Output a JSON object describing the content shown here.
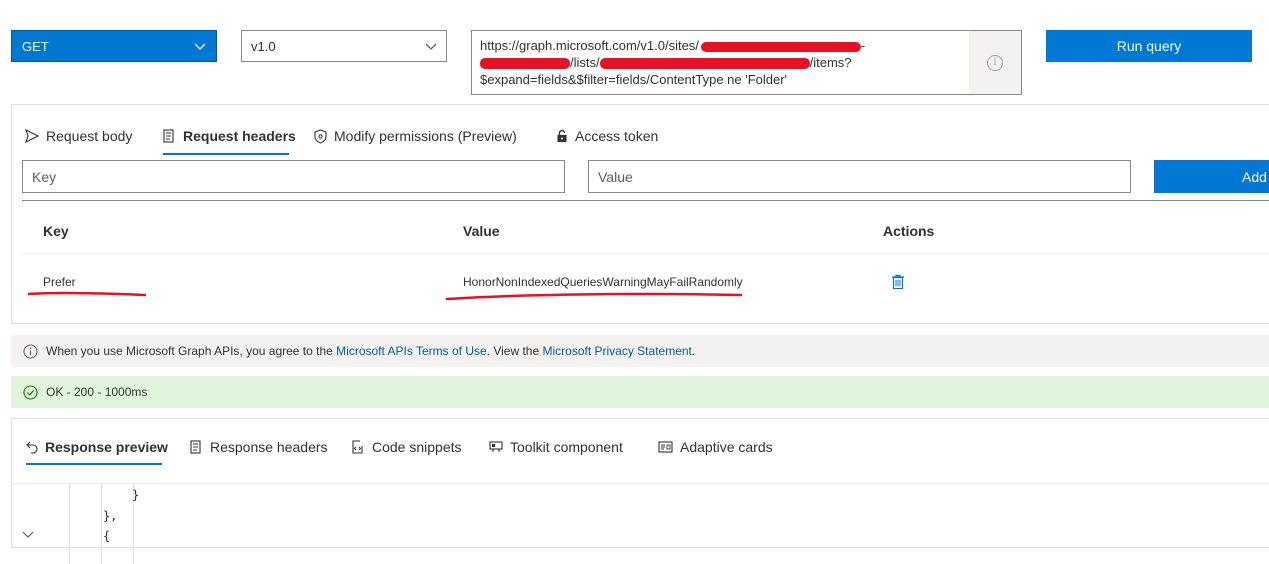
{
  "query_bar": {
    "method": "GET",
    "version": "v1.0",
    "url_line1": "https://graph.microsoft.com/v1.0/sites/",
    "url_line1_tail": "-",
    "url_line2_a": "/lists/",
    "url_line2_b": "/items?",
    "url_line3": "$expand=fields&$filter=fields/ContentType ne 'Folder'",
    "run_label": "Run query"
  },
  "request_tabs": [
    {
      "label": "Request body",
      "icon": "send-icon"
    },
    {
      "label": "Request headers",
      "icon": "headers-doc-icon"
    },
    {
      "label": "Modify permissions (Preview)",
      "icon": "shield-icon"
    },
    {
      "label": "Access token",
      "icon": "lock-icon"
    }
  ],
  "header_form": {
    "key_placeholder": "Key",
    "value_placeholder": "Value",
    "add_label": "Add"
  },
  "headers_table": {
    "columns": [
      "Key",
      "Value",
      "Actions"
    ],
    "rows": [
      {
        "key": "Prefer",
        "value": "HonorNonIndexedQueriesWarningMayFailRandomly",
        "action_icon": "delete-icon"
      }
    ]
  },
  "info_bar": {
    "text_before": "When you use Microsoft Graph APIs, you agree to the",
    "link1": "Microsoft APIs Terms of Use",
    "text_mid": ". View the",
    "link2": "Microsoft Privacy Statement",
    "text_after": "."
  },
  "status": {
    "text": "OK - 200 - 1000ms"
  },
  "response_tabs": [
    {
      "label": "Response preview",
      "icon": "undo-arrow-icon"
    },
    {
      "label": "Response headers",
      "icon": "headers-doc-icon"
    },
    {
      "label": "Code snippets",
      "icon": "code-icon"
    },
    {
      "label": "Toolkit component",
      "icon": "toolkit-icon"
    },
    {
      "label": "Adaptive cards",
      "icon": "card-icon"
    }
  ],
  "code_lines": [
    "}",
    "},",
    "{"
  ],
  "colors": {
    "accent": "#0078d4",
    "success_bg": "#dff6dd",
    "annotation_red": "#e81123",
    "redaction_red": "#e81123"
  }
}
